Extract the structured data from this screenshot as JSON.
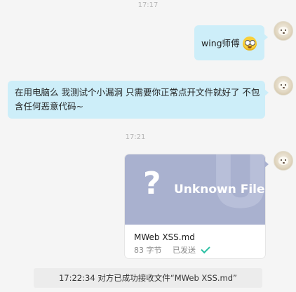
{
  "chat": {
    "timestamps": [
      "17:17",
      "17:21"
    ],
    "messages": [
      {
        "side": "right",
        "text": "wing师傅",
        "emoji": "emoji-face-icon"
      },
      {
        "side": "right",
        "text": "在用电脑么 我测试个小漏洞 只需要你正常点开文件就好了 不包含任何恶意代码~"
      }
    ],
    "file": {
      "preview_title": "Unknown File",
      "preview_symbol": "?",
      "name": "MWeb XSS.md",
      "size": "83 字节",
      "status": "已发送"
    },
    "notice": "17:22:34 对方已成功接收文件“MWeb XSS.md”"
  },
  "colors": {
    "bubble": "#cdeef9",
    "file_preview": "#a9b1cf",
    "check": "#2bc0a3"
  }
}
